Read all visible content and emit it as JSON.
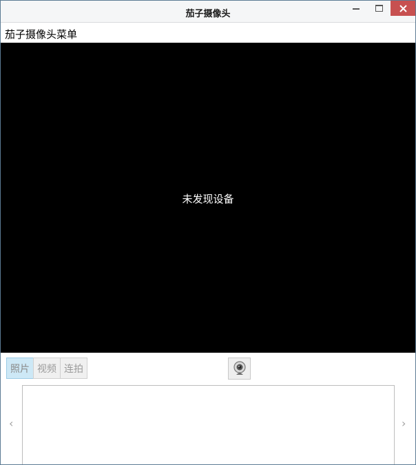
{
  "window": {
    "title": "茄子摄像头"
  },
  "menu": {
    "items": [
      "茄子摄像头菜单"
    ]
  },
  "video": {
    "message": "未发现设备"
  },
  "modes": {
    "items": [
      {
        "label": "照片",
        "active": true
      },
      {
        "label": "视频",
        "active": false
      },
      {
        "label": "连拍",
        "active": false
      }
    ]
  },
  "icons": {
    "capture": "webcam-icon",
    "prev": "chevron-left-icon",
    "next": "chevron-right-icon"
  },
  "arrows": {
    "prev": "‹",
    "next": "›"
  },
  "colors": {
    "close_button": "#c75050",
    "active_mode": "#cde8f6",
    "video_bg": "#000000"
  }
}
